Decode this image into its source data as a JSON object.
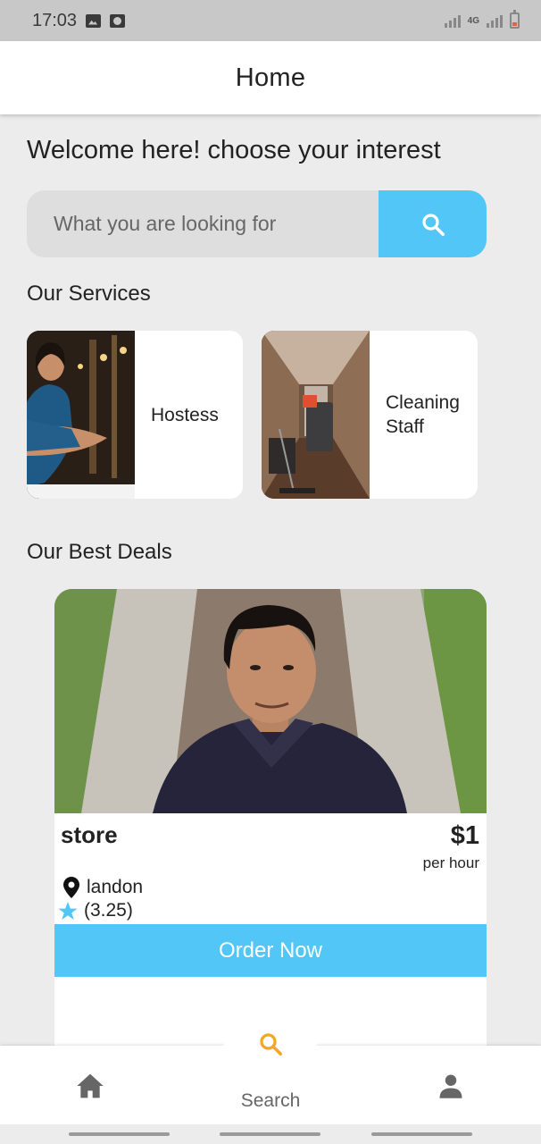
{
  "status_bar": {
    "time": "17:03",
    "network": "4G",
    "icons": [
      "image-icon",
      "record-icon",
      "signal-icon",
      "battery-icon"
    ]
  },
  "app_bar": {
    "title": "Home"
  },
  "welcome": "Welcome here! choose your interest",
  "search": {
    "placeholder": "What you are looking for",
    "value": "",
    "button_icon": "search-icon"
  },
  "services": {
    "title": "Our Services",
    "items": [
      {
        "label": "Hostess",
        "image": "hostess-photo"
      },
      {
        "label": "Cleaning Staff",
        "image": "cleaning-staff-photo"
      }
    ]
  },
  "deals": {
    "title": "Our Best Deals",
    "items": [
      {
        "store": "store",
        "price": "$1",
        "unit": "per hour",
        "location": "landon",
        "rating": "(3.25)",
        "order_label": "Order Now"
      }
    ]
  },
  "bottom_nav": {
    "search_label": "Search",
    "icons": [
      "home-icon",
      "search-icon",
      "profile-icon"
    ]
  },
  "colors": {
    "accent": "#52c6f7",
    "fab_search": "#f5a623",
    "background": "#ececec",
    "text": "#222222"
  }
}
